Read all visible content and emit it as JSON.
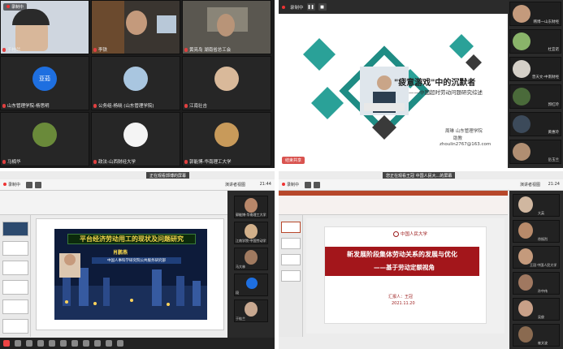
{
  "q1": {
    "rec": "录制中",
    "tiles": [
      {
        "name": "于桂兰",
        "kind": "photo"
      },
      {
        "name": "李铁",
        "kind": "photo"
      },
      {
        "name": "黄亮岛 湖南省总工会",
        "kind": "photo"
      },
      {
        "name": "山东管理学院-杨思明",
        "kind": "text",
        "avatar_text": "亚茹"
      },
      {
        "name": "公务组-杨晓 (山东管理学院)",
        "kind": "photo"
      },
      {
        "name": "江南壮吉",
        "kind": "photo"
      },
      {
        "name": "马楠华",
        "kind": "photo"
      },
      {
        "name": "政法-山西财经大学",
        "kind": "photo"
      },
      {
        "name": "郭能博-华南理工大学",
        "kind": "photo"
      }
    ]
  },
  "q2": {
    "rec": "录制中",
    "share_label": "结束共享",
    "slide": {
      "title": "\"疲意游戏\"中的沉默者",
      "subtitle": "——中国超时劳动问题研究综述",
      "author": "周琳  山东管理学院",
      "role": "助教",
      "email": "zhoulin2767@163.com"
    },
    "side": [
      "韩博一山东财经",
      "杜宜诺",
      "曾天文-中南财经",
      "郭红玲",
      "黄惠玲",
      "岳玉兰"
    ]
  },
  "q3": {
    "tab": "正在观看郭博的屏幕",
    "rec": "录制中",
    "time": "21:44",
    "view_label": "演讲者视图",
    "slide": {
      "title": "平台经济劳动用工的现状及问题研究",
      "author": "肖鹏燕",
      "affiliation": "中国人事科学研究院公共服务研究部"
    },
    "tiles": [
      "郭能博-华南理工大学",
      "江南学院-中国劳动学",
      "马大林",
      "段",
      "于桂兰"
    ]
  },
  "q4": {
    "tab": "您正在观看王冠 中国人民大...的屏幕",
    "rec": "录制中",
    "time": "21:24",
    "view_label": "演讲者视图",
    "slide": {
      "logo": "中国人民大学",
      "title": "新发展阶段集体劳动关系的发展与优化",
      "subtitle": "——基于劳动定额视角",
      "reporter": "汇报人：王冠",
      "date": "2021.11.20"
    },
    "tiles": [
      "大英",
      "徐振烈",
      "王冠 中国人民大学",
      "孙中伟",
      "吴俊",
      "崔文波"
    ]
  }
}
